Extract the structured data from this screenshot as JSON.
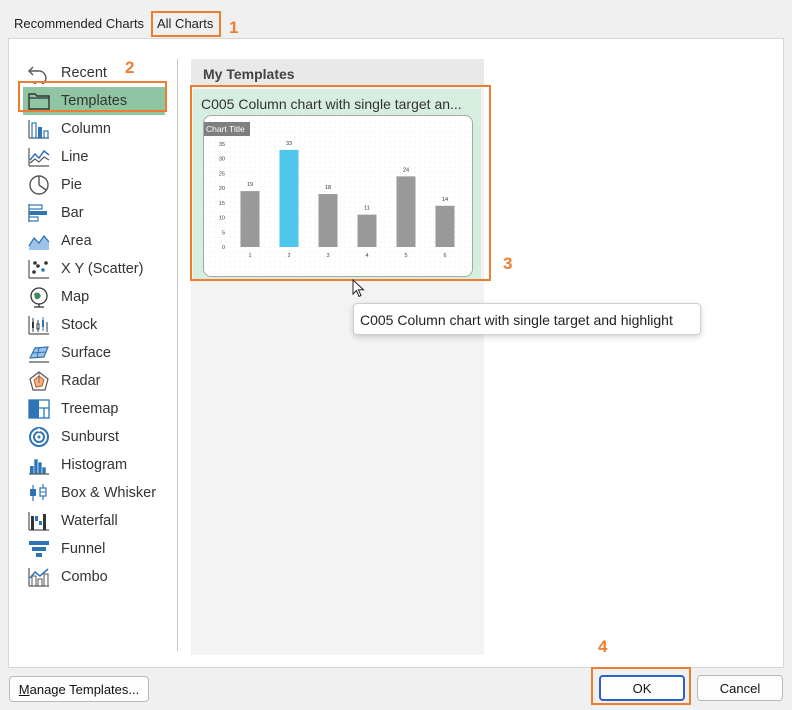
{
  "tabs": [
    {
      "label": "Recommended Charts"
    },
    {
      "label": "All Charts"
    }
  ],
  "annotations": [
    "1",
    "2",
    "3",
    "4"
  ],
  "chart_types": [
    {
      "label": "Recent",
      "icon": "recent-icon"
    },
    {
      "label": "Templates",
      "icon": "folder-icon"
    },
    {
      "label": "Column",
      "icon": "column-chart-icon"
    },
    {
      "label": "Line",
      "icon": "line-chart-icon"
    },
    {
      "label": "Pie",
      "icon": "pie-chart-icon"
    },
    {
      "label": "Bar",
      "icon": "bar-chart-icon"
    },
    {
      "label": "Area",
      "icon": "area-chart-icon"
    },
    {
      "label": "X Y (Scatter)",
      "icon": "scatter-chart-icon"
    },
    {
      "label": "Map",
      "icon": "map-chart-icon"
    },
    {
      "label": "Stock",
      "icon": "stock-chart-icon"
    },
    {
      "label": "Surface",
      "icon": "surface-chart-icon"
    },
    {
      "label": "Radar",
      "icon": "radar-chart-icon"
    },
    {
      "label": "Treemap",
      "icon": "treemap-chart-icon"
    },
    {
      "label": "Sunburst",
      "icon": "sunburst-chart-icon"
    },
    {
      "label": "Histogram",
      "icon": "histogram-chart-icon"
    },
    {
      "label": "Box & Whisker",
      "icon": "box-whisker-chart-icon"
    },
    {
      "label": "Waterfall",
      "icon": "waterfall-chart-icon"
    },
    {
      "label": "Funnel",
      "icon": "funnel-chart-icon"
    },
    {
      "label": "Combo",
      "icon": "combo-chart-icon"
    }
  ],
  "selected_type": "Templates",
  "templates_header": "My Templates",
  "template": {
    "name": "C005 Column chart with single target an...",
    "tooltip": "C005 Column chart with single target and highlight"
  },
  "chart_data": {
    "type": "bar",
    "title": "Chart Title",
    "categories": [
      "1",
      "2",
      "3",
      "4",
      "5",
      "6"
    ],
    "values": [
      19,
      33,
      18,
      11,
      24,
      14
    ],
    "highlight_index": 1,
    "ylim": [
      0,
      35
    ],
    "yticks": [
      "0",
      "5",
      "10",
      "15",
      "20",
      "25",
      "30",
      "35"
    ],
    "colors": {
      "bar": "#999999",
      "highlight": "#4fc6ee",
      "title_bg": "#7f7f7f"
    }
  },
  "buttons": {
    "manage": {
      "underlined": "M",
      "rest": "anage Templates..."
    },
    "ok": "OK",
    "cancel": "Cancel"
  },
  "colors": {
    "accent": "#ed7d31",
    "selection": "#8fc5a3",
    "ok_border": "#2a62c9"
  }
}
